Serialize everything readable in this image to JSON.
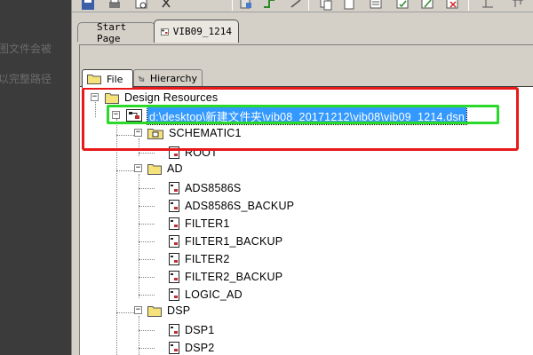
{
  "background_text": {
    "line1": "图文件会被",
    "line2": "以完整路径"
  },
  "document_tabs": [
    {
      "label": "Start Page"
    },
    {
      "label": "VIB09_1214"
    }
  ],
  "panel_tabs": [
    {
      "label": "File"
    },
    {
      "label": "Hierarchy"
    }
  ],
  "tree": {
    "root": "Design Resources",
    "design_file": "d:\\desktop\\新建文件夹\\vib08_20171212\\vib08\\vib09_1214.dsn",
    "folders": [
      {
        "name": "SCHEMATIC1",
        "pages": [
          "ROOT"
        ]
      },
      {
        "name": "AD",
        "pages": [
          "ADS8586S",
          "ADS8586S_BACKUP",
          "FILTER1",
          "FILTER1_BACKUP",
          "FILTER2",
          "FILTER2_BACKUP",
          "LOGIC_AD"
        ]
      },
      {
        "name": "DSP",
        "pages": [
          "DSP1",
          "DSP2"
        ]
      }
    ]
  },
  "colors": {
    "highlight_red": "#e8191b",
    "highlight_green": "#2ad92a",
    "selection": "#3399ff"
  }
}
